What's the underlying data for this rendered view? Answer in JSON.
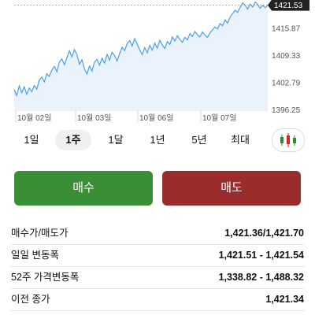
{
  "chart_data": {
    "type": "line",
    "y_ticks": [
      1396.25,
      1402.79,
      1409.33,
      1415.87
    ],
    "y_tick_labels": [
      "1396.25",
      "1402.79",
      "1409.33",
      "1415.87"
    ],
    "x_tick_labels": [
      "10월 02일",
      "10월 03일",
      "10월 06일",
      "10월 07일"
    ],
    "current_price": 1421.53,
    "current_price_label": "1421.53",
    "ylim": [
      1396.25,
      1422.4
    ],
    "grid": false,
    "series": [
      {
        "color": "#4a9fe8",
        "values": [
          1401.2,
          1399.8,
          1402.1,
          1400.5,
          1401.9,
          1400.1,
          1401.6,
          1400.7,
          1402.2,
          1401.3,
          1403.5,
          1404.2,
          1403.1,
          1405.0,
          1404.4,
          1405.9,
          1406.8,
          1405.5,
          1407.9,
          1408.6,
          1407.2,
          1408.9,
          1410.5,
          1409.1,
          1410.8,
          1409.6,
          1407.3,
          1408.4,
          1406.2,
          1405.0,
          1406.9,
          1405.7,
          1407.8,
          1408.5,
          1407.1,
          1408.8,
          1407.6,
          1409.7,
          1408.3,
          1410.2,
          1409.4,
          1408.1,
          1409.9,
          1411.4,
          1410.6,
          1412.3,
          1413.0,
          1411.7,
          1413.5,
          1412.2,
          1410.8,
          1409.6,
          1411.3,
          1410.1,
          1411.9,
          1410.7,
          1412.4,
          1411.2,
          1413.1,
          1412.0,
          1411.1,
          1412.8,
          1412.1,
          1413.9,
          1412.9,
          1414.2,
          1413.3,
          1412.6,
          1413.8,
          1413.2,
          1414.7,
          1414.0,
          1415.2,
          1414.4,
          1413.9,
          1415.1,
          1414.3,
          1413.8,
          1414.9,
          1415.6,
          1416.3,
          1415.8,
          1417.1,
          1416.6,
          1418.0,
          1417.2,
          1418.7,
          1419.5,
          1420.3,
          1419.8,
          1421.0,
          1422.1,
          1421.5,
          1420.6,
          1421.8,
          1421.1,
          1422.3,
          1421.7,
          1420.8,
          1421.5,
          1420.9,
          1421.53
        ]
      }
    ]
  },
  "tabs": {
    "items": [
      {
        "label": "1일",
        "active": false
      },
      {
        "label": "1주",
        "active": true
      },
      {
        "label": "1달",
        "active": false
      },
      {
        "label": "1년",
        "active": false
      },
      {
        "label": "5년",
        "active": false
      },
      {
        "label": "최대",
        "active": false
      }
    ],
    "chart_type_icon": "candlestick-icon"
  },
  "actions": {
    "buy_label": "매수",
    "sell_label": "매도",
    "buy_color": "#3a8f36",
    "sell_color": "#9b2c2c"
  },
  "info": [
    {
      "label": "매수가/매도가",
      "value": "1,421.36/1,421.70"
    },
    {
      "label": "일일 변동폭",
      "value": "1,421.51 - 1,421.54"
    },
    {
      "label": "52주 가격변동폭",
      "value": "1,338.82 - 1,488.32"
    },
    {
      "label": "이전 종가",
      "value": "1,421.34"
    }
  ]
}
